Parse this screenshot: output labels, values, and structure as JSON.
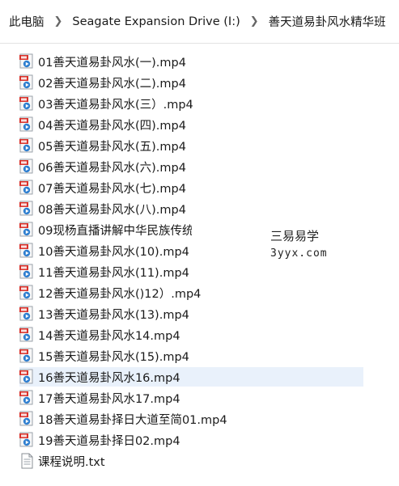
{
  "breadcrumb": {
    "items": [
      "此电脑",
      "Seagate Expansion Drive (I:)",
      "善天道易卦风水精华班"
    ]
  },
  "files": [
    {
      "name": "01善天道易卦风水(一).mp4",
      "type": "video"
    },
    {
      "name": "02善天道易卦风水(二).mp4",
      "type": "video"
    },
    {
      "name": "03善天道易卦风水(三）.mp4",
      "type": "video"
    },
    {
      "name": "04善天道易卦风水(四).mp4",
      "type": "video"
    },
    {
      "name": "05善天道易卦风水(五).mp4",
      "type": "video"
    },
    {
      "name": "06善天道易卦风水(六).mp4",
      "type": "video"
    },
    {
      "name": "07善天道易卦风水(七).mp4",
      "type": "video"
    },
    {
      "name": "08善天道易卦风水(八).mp4",
      "type": "video"
    },
    {
      "name": "09现杨直播讲解中华民族传统",
      "type": "video"
    },
    {
      "name": "10善天道易卦风水(10).mp4",
      "type": "video"
    },
    {
      "name": "11善天道易卦风水(11).mp4",
      "type": "video"
    },
    {
      "name": "12善天道易卦风水()12）.mp4",
      "type": "video"
    },
    {
      "name": "13善天道易卦风水(13).mp4",
      "type": "video"
    },
    {
      "name": "14善天道易卦风水14.mp4",
      "type": "video"
    },
    {
      "name": "15善天道易卦风水(15).mp4",
      "type": "video"
    },
    {
      "name": "16善天道易卦风水16.mp4",
      "type": "video"
    },
    {
      "name": "17善天道易卦风水17.mp4",
      "type": "video"
    },
    {
      "name": "18善天道易卦择日大道至简01.mp4",
      "type": "video"
    },
    {
      "name": "19善天道易卦择日02.mp4",
      "type": "video"
    },
    {
      "name": "课程说明.txt",
      "type": "text"
    }
  ],
  "selected_index": 15,
  "watermark": {
    "line1": "三易易学",
    "line2": "3yyx.com"
  }
}
